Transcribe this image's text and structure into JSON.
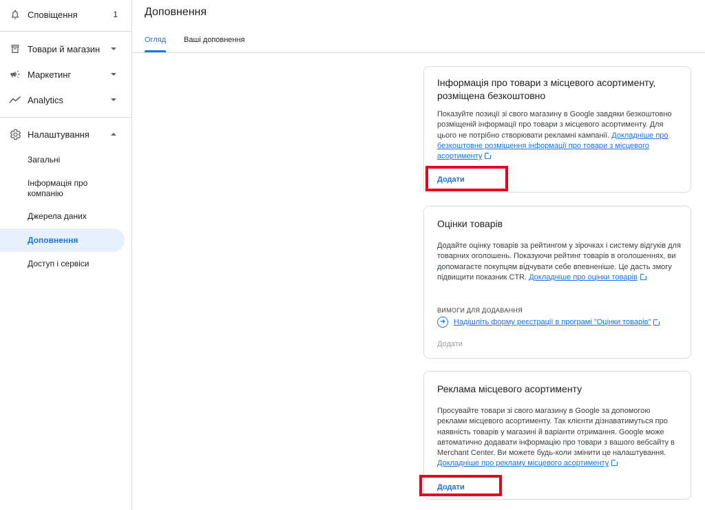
{
  "sidebar": {
    "notifications": {
      "label": "Сповіщення",
      "count": "1"
    },
    "products": {
      "label": "Товари й магазин"
    },
    "marketing": {
      "label": "Маркетинг"
    },
    "analytics": {
      "label": "Analytics"
    },
    "settings": {
      "label": "Налаштування",
      "items": [
        "Загальні",
        "Інформація про компанію",
        "Джерела даних",
        "Доповнення",
        "Доступ і сервіси"
      ]
    }
  },
  "header": {
    "title": "Доповнення",
    "tabs": [
      {
        "label": "Огляд"
      },
      {
        "label": "Ваші доповнення"
      }
    ]
  },
  "cards": [
    {
      "title": "Інформація про товари з місцевого асортименту, розміщена безкоштовно",
      "description": "Показуйте позиції зі свого магазину в Google завдяки безкоштовно розміщеній інформації про товари з місцевого асортименту. Для цього не потрібно створювати рекламні кампанії.",
      "link": "Докладніше про безкоштовне розміщення інформації про товари з місцевого асортименту",
      "action": "Додати"
    },
    {
      "title": "Оцінки товарів",
      "description": "Додайте оцінку товарів за рейтингом у зірочках і систему відгуків для товарних оголошень. Показуючи рейтинг товарів в оголошеннях, ви допомагаєте покупцям відчувати себе впевненіше. Це дасть змогу підвищити показник CTR.",
      "link": "Докладніше про оцінки товарів",
      "requirements_label": "ВИМОГИ ДЛЯ ДОДАВАННЯ",
      "requirement_link": "Надішліть форму реєстрації в програмі \"Оцінки товарів\"",
      "action": "Додати"
    },
    {
      "title": "Реклама місцевого асортименту",
      "description": "Просувайте товари зі свого магазину в Google за допомогою реклами місцевого асортименту. Так клієнти дізнаватимуться про наявність товарів у магазині й варіанти отримання. Google може автоматично додавати інформацію про товари з вашого вебсайту в Merchant Center. Ви можете будь-коли змінити це налаштування.",
      "link": "Докладніше про рекламу місцевого асортименту",
      "action": "Додати"
    }
  ],
  "colors": {
    "accent": "#1a73e8",
    "highlight": "#e8001c",
    "active_bg": "#e8f0fe"
  }
}
